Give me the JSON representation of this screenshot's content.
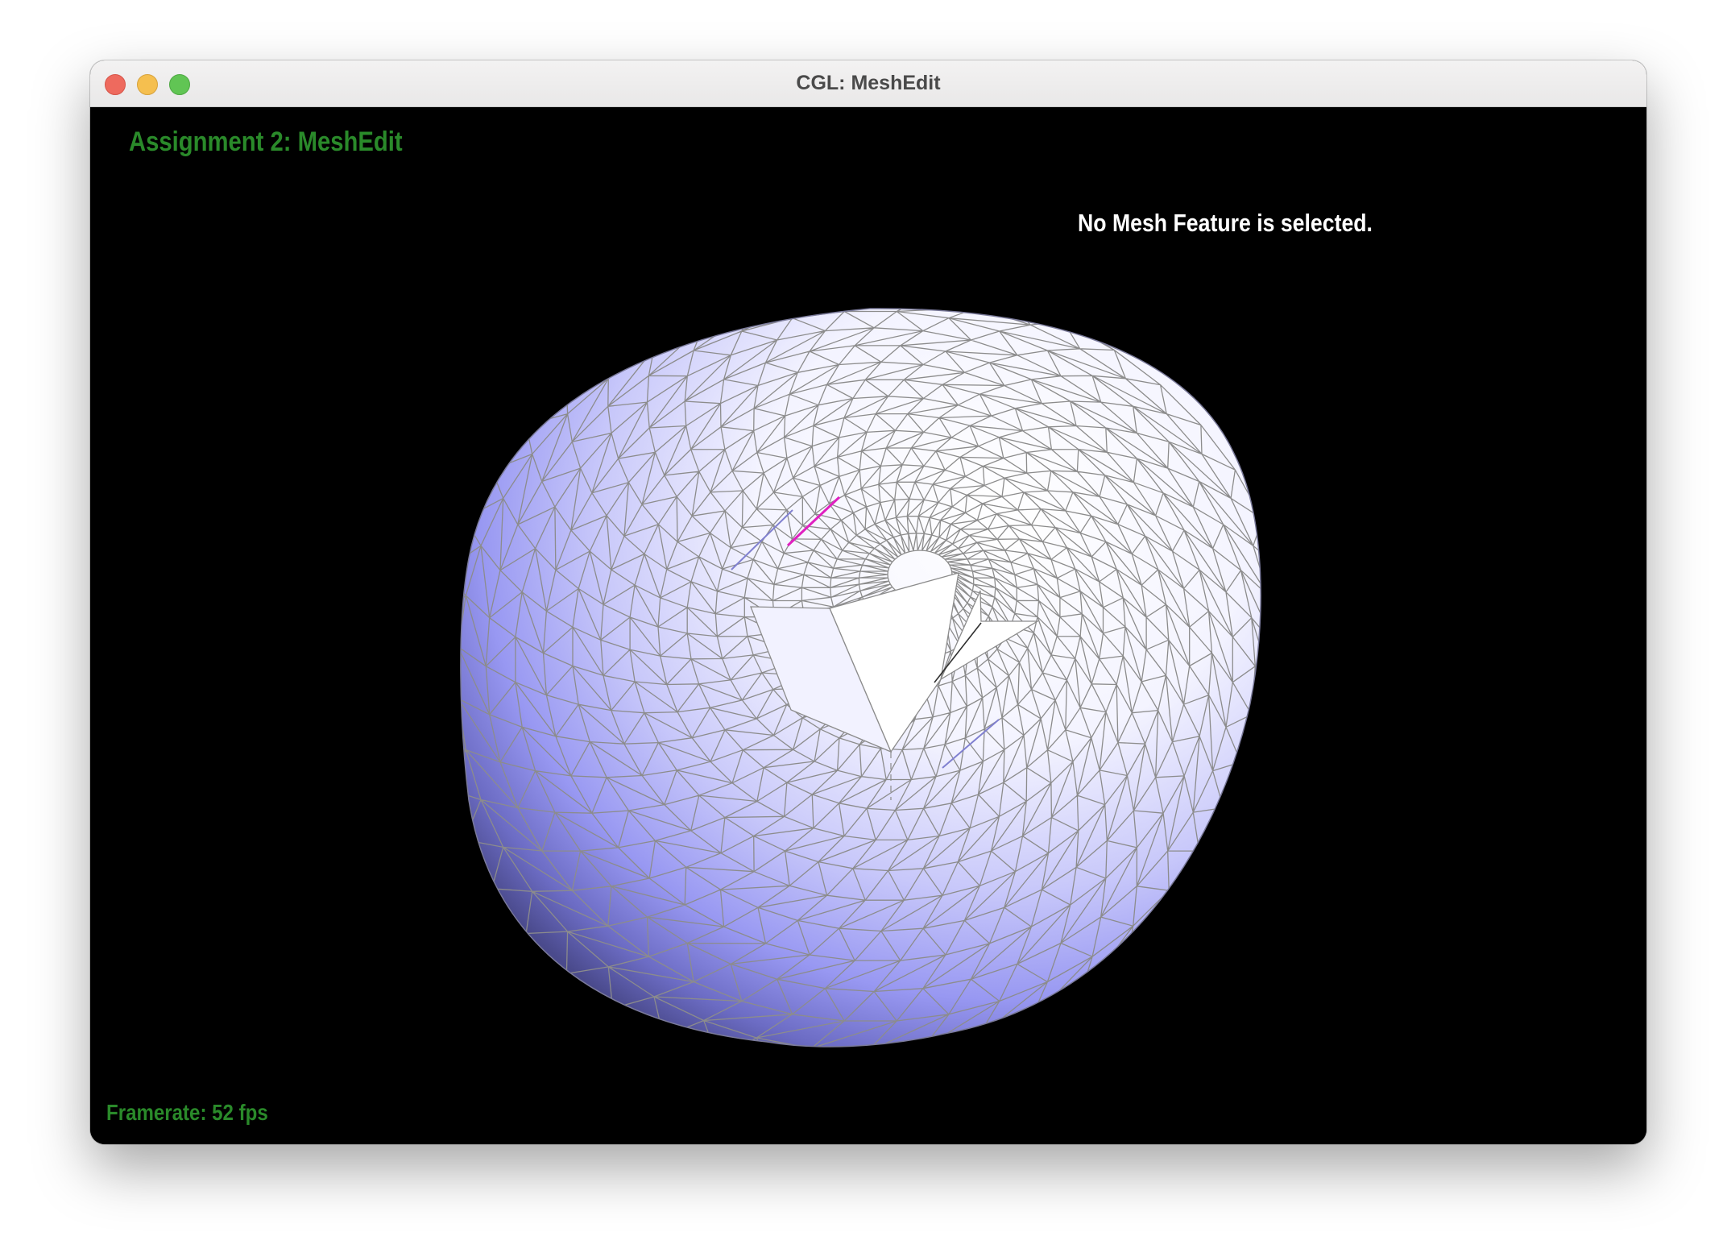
{
  "window": {
    "title": "CGL: MeshEdit",
    "buttons": {
      "close_color": "#ee6a5e",
      "minimize_color": "#f5bf4f",
      "zoom_color": "#61c554"
    }
  },
  "hud": {
    "assignment_title": "Assignment 2: MeshEdit",
    "selection_status": "No Mesh Feature is selected.",
    "framerate_label": "Framerate: 52 fps",
    "text_green": "#2a8a2a",
    "text_white": "#ffffff"
  },
  "scene": {
    "background": "#000000",
    "mesh_base_color": "#9a9aff",
    "mesh_highlight_color": "#ffffff",
    "wireframe_color": "#8c8c8c",
    "selected_edge_color": "#e020c0"
  }
}
